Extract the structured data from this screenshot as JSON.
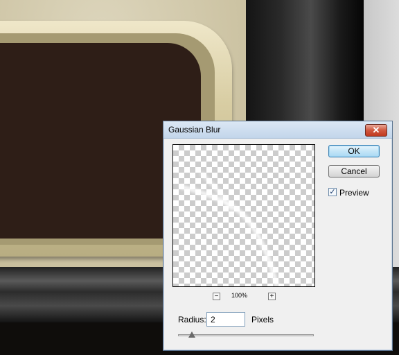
{
  "dialog": {
    "title": "Gaussian Blur",
    "close_label": "✕",
    "zoom_level": "100%",
    "zoom_out_label": "−",
    "zoom_in_label": "+",
    "ok_label": "OK",
    "cancel_label": "Cancel",
    "preview_label": "Preview",
    "preview_checked": true,
    "preview_check_mark": "✓",
    "radius_label": "Radius:",
    "radius_value": "2",
    "units_label": "Pixels",
    "slider_fraction": 0.1
  },
  "colors": {
    "accent_blue": "#3c7fb1",
    "close_red": "#c0391f",
    "screen_brown": "#2e1e17",
    "frame_cream": "#d8cda3"
  }
}
